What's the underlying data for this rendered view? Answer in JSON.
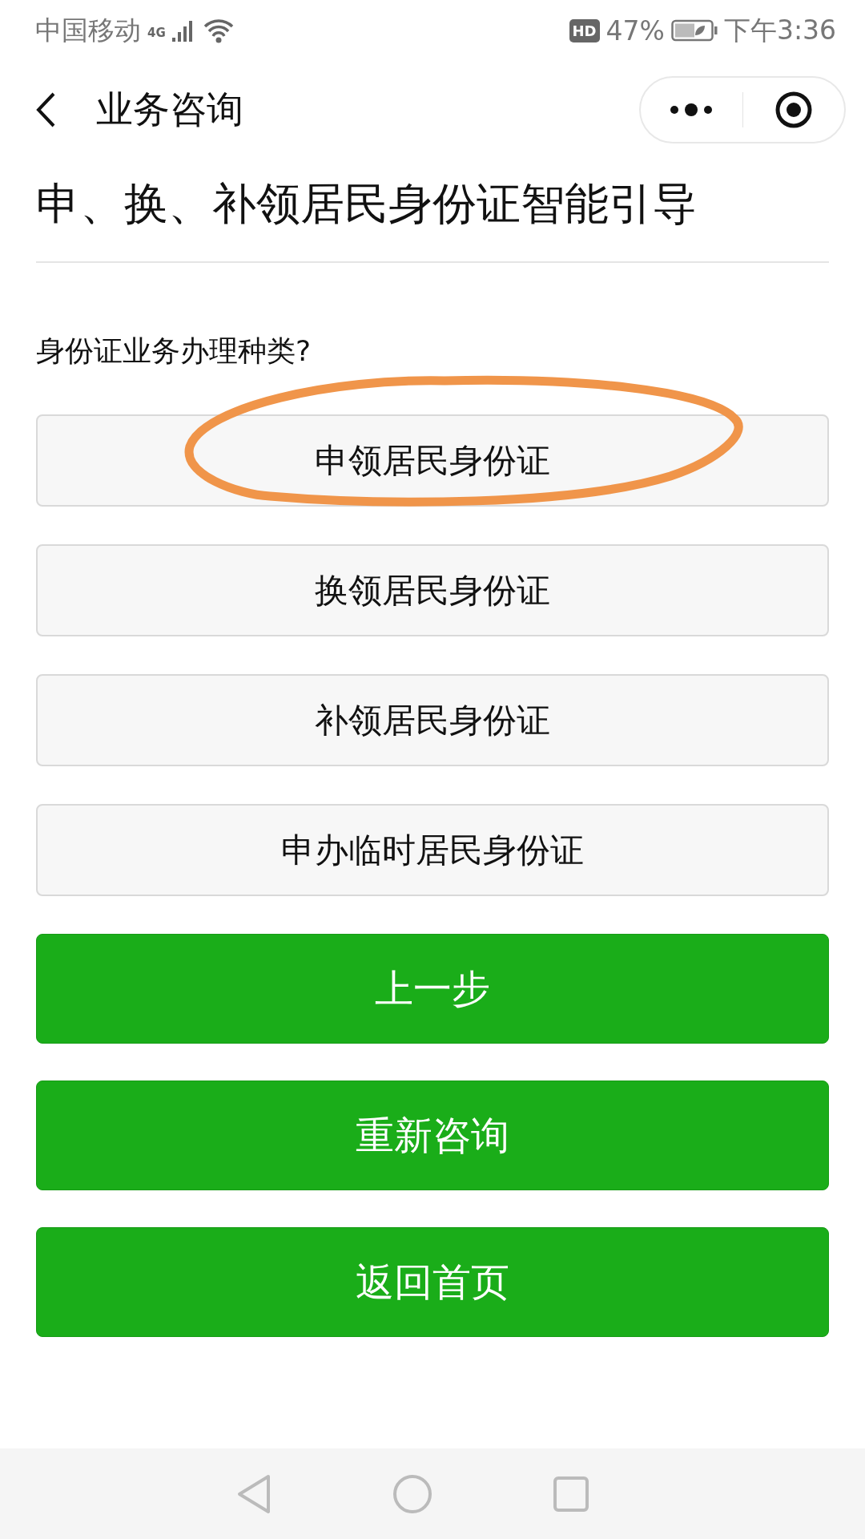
{
  "status_bar": {
    "carrier": "中国移动",
    "network": "4G",
    "hd_badge": "HD",
    "battery_percent": "47%",
    "time": "下午3:36"
  },
  "nav": {
    "title": "业务咨询"
  },
  "heading": "申、换、补领居民身份证智能引导",
  "question": "身份证业务办理种类?",
  "options": [
    {
      "label": "申领居民身份证",
      "circled": true
    },
    {
      "label": "换领居民身份证",
      "circled": false
    },
    {
      "label": "补领居民身份证",
      "circled": false
    },
    {
      "label": "申办临时居民身份证",
      "circled": false
    }
  ],
  "actions": [
    "上一步",
    "重新咨询",
    "返回首页"
  ]
}
